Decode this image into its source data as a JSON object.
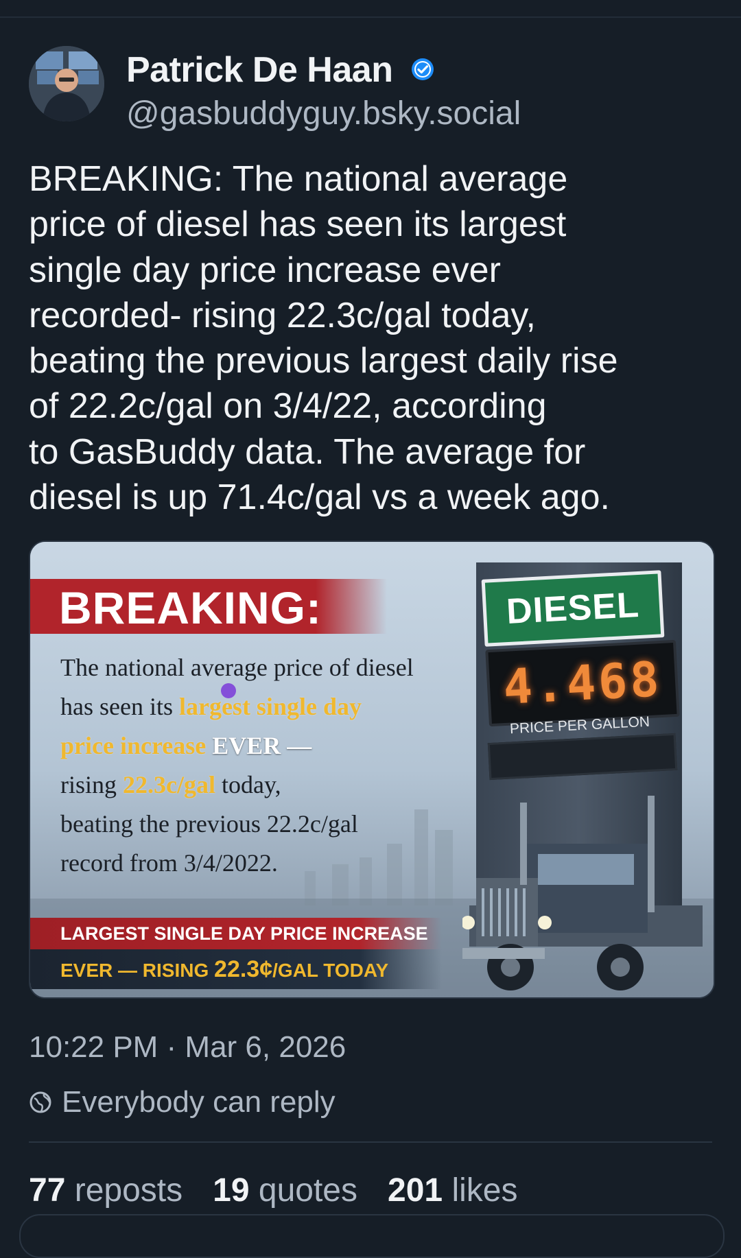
{
  "author": {
    "display_name": "Patrick De Haan",
    "handle": "@gasbuddyguy.bsky.social",
    "verified_icon": "verified-check-icon",
    "verified_color": "#1d8cf8"
  },
  "post": {
    "lines": [
      "BREAKING: The national average",
      "price of diesel has seen its largest",
      "single day price increase ever",
      "recorded- rising 22.3c/gal today,",
      "beating the previous largest daily rise",
      "of 22.2c/gal on 3/4/22, according",
      "to GasBuddy data. The average for",
      "diesel is up 71.4c/gal vs a week ago."
    ]
  },
  "image": {
    "title": "BREAKING:",
    "body": {
      "l1": "The national average price of diesel",
      "l2a": "has seen its ",
      "l2b": "largest single day",
      "l3a": "price increase",
      "l3b": " EVER —",
      "l4a": "rising ",
      "l4b": "22.3c/gal",
      "l4c": " today,",
      "l5": "beating the previous 22.2c/gal",
      "l6": "record from 3/4/2022."
    },
    "footer": {
      "line1": "LARGEST SINGLE DAY PRICE INCREASE",
      "line2a": "EVER — RISING ",
      "line2b": "22.3¢",
      "line2c": "/GAL TODAY"
    },
    "sign": {
      "label": "DIESEL",
      "price": "4.468",
      "caption": "PRICE PER GALLON"
    },
    "colors": {
      "banner_red": "#b1242b",
      "highlight_yellow": "#f0b82e",
      "sign_green": "#1f7a4a",
      "led_orange": "#f08a3a"
    }
  },
  "meta": {
    "timestamp": "10:22 PM · Mar 6, 2026",
    "reply_setting": "Everybody can reply",
    "reply_icon": "globe-icon"
  },
  "stats": [
    {
      "count": "77",
      "label": "reposts"
    },
    {
      "count": "19",
      "label": "quotes"
    },
    {
      "count": "201",
      "label": "likes"
    }
  ]
}
